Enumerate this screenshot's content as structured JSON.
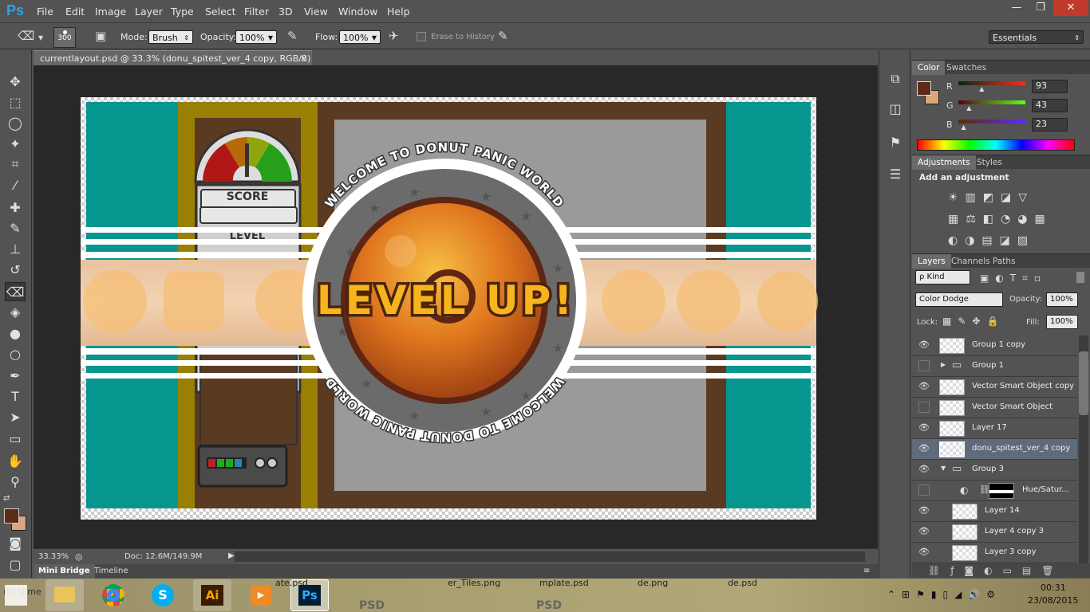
{
  "app": {
    "logo": "Ps",
    "menus": [
      "File",
      "Edit",
      "Image",
      "Layer",
      "Type",
      "Select",
      "Filter",
      "3D",
      "View",
      "Window",
      "Help"
    ],
    "window_controls": [
      "—",
      "❐",
      "✕"
    ]
  },
  "options": {
    "brush_size": "300",
    "mode_label": "Mode:",
    "mode_value": "Brush",
    "opacity_label": "Opacity:",
    "opacity_value": "100%",
    "flow_label": "Flow:",
    "flow_value": "100%",
    "erase_history": "Erase to History",
    "workspace": "Essentials"
  },
  "document": {
    "tab_title": "currentlayout.psd @ 33.3% (donu_spitest_ver_4 copy, RGB/8)",
    "close": "×",
    "zoom": "33.33%",
    "doc_size": "Doc: 12.6M/149.9M"
  },
  "artwork": {
    "level_up": "LEVEL UP!",
    "circle_text": "WELCOME TO DONUT PANIC WORLD",
    "score": "SCORE",
    "level": "LEVEL"
  },
  "bottom_tabs": [
    "Mini Bridge",
    "Timeline"
  ],
  "color_panel": {
    "tabs": [
      "Color",
      "Swatches"
    ],
    "r_label": "R",
    "g_label": "G",
    "b_label": "B",
    "r": "93",
    "g": "43",
    "b": "23",
    "r_frac": 0.36,
    "g_frac": 0.17,
    "b_frac": 0.09,
    "fg": "#5d2b17",
    "bg": "#d9a77a"
  },
  "adjustments": {
    "tabs": [
      "Adjustments",
      "Styles"
    ],
    "hint": "Add an adjustment"
  },
  "layers_panel": {
    "tabs": [
      "Layers",
      "Channels",
      "Paths"
    ],
    "filter": "ρ Kind",
    "blend": "Color Dodge",
    "opacity_label": "Opacity:",
    "opacity": "100%",
    "lock_label": "Lock:",
    "fill_label": "Fill:",
    "fill": "100%",
    "layers": [
      {
        "name": "Group 1 copy",
        "visible": true
      },
      {
        "name": "Group 1",
        "visible": false
      },
      {
        "name": "Vector Smart Object copy",
        "visible": true
      },
      {
        "name": "Vector Smart Object",
        "visible": false
      },
      {
        "name": "Layer 17",
        "visible": true
      },
      {
        "name": "donu_spitest_ver_4 copy",
        "visible": true
      },
      {
        "name": "Group 3",
        "visible": true
      },
      {
        "name": "Hue/Satur...",
        "visible": false
      },
      {
        "name": "Layer 14",
        "visible": true
      },
      {
        "name": "Layer 4 copy 3",
        "visible": true
      },
      {
        "name": "Layer 3 copy",
        "visible": true
      }
    ]
  },
  "taskbar": {
    "time": "00:31",
    "date": "23/08/2015",
    "left_text": "(k) slime",
    "files": [
      "ate.psd",
      "er_Tiles.png",
      "mplate.psd",
      "de.png",
      "de.psd"
    ],
    "psd_label": "PSD"
  }
}
